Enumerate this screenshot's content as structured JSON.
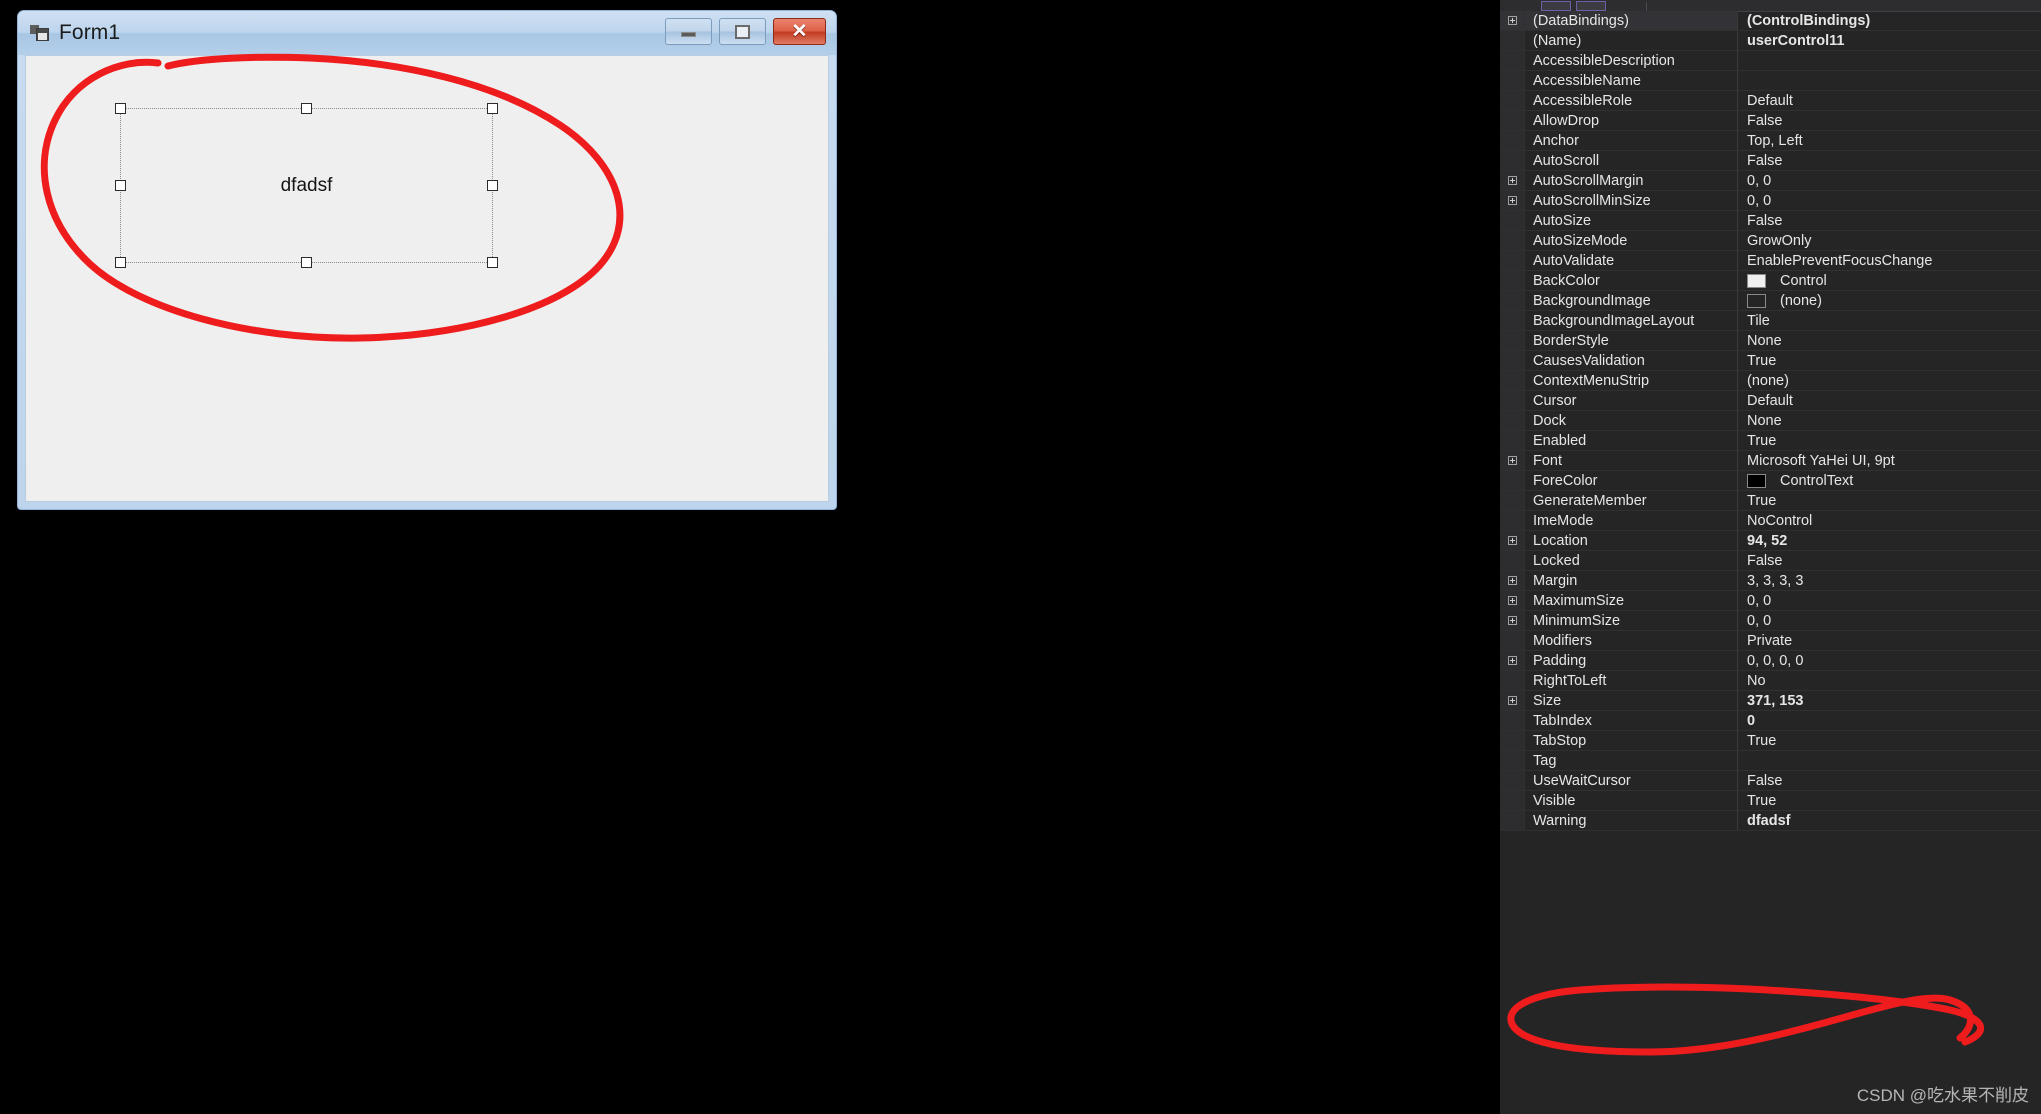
{
  "designer": {
    "window_title": "Form1",
    "icon": "form-icon",
    "controls": {
      "minimize_label": "—",
      "maximize_label": "□",
      "close_label": "✕"
    },
    "selected_control": {
      "label": "dfadsf",
      "name": "userControl11",
      "location": "94, 52",
      "size": "371, 153"
    }
  },
  "toolbar": {
    "items": [
      "categorized-icon",
      "alphabetical-icon",
      "properties-icon",
      "events-icon",
      "property-pages-icon"
    ]
  },
  "property_grid": {
    "rows": [
      {
        "name": "(DataBindings)",
        "value": "(ControlBindings)",
        "expandable": true,
        "bold": true,
        "selected": true
      },
      {
        "name": "(Name)",
        "value": "userControl11",
        "expandable": false,
        "bold": true,
        "selected": false
      },
      {
        "name": "AccessibleDescription",
        "value": "",
        "expandable": false,
        "bold": false,
        "selected": false
      },
      {
        "name": "AccessibleName",
        "value": "",
        "expandable": false,
        "bold": false,
        "selected": false
      },
      {
        "name": "AccessibleRole",
        "value": "Default",
        "expandable": false,
        "bold": false,
        "selected": false
      },
      {
        "name": "AllowDrop",
        "value": "False",
        "expandable": false,
        "bold": false,
        "selected": false
      },
      {
        "name": "Anchor",
        "value": "Top, Left",
        "expandable": false,
        "bold": false,
        "selected": false
      },
      {
        "name": "AutoScroll",
        "value": "False",
        "expandable": false,
        "bold": false,
        "selected": false
      },
      {
        "name": "AutoScrollMargin",
        "value": "0, 0",
        "expandable": true,
        "bold": false,
        "selected": false
      },
      {
        "name": "AutoScrollMinSize",
        "value": "0, 0",
        "expandable": true,
        "bold": false,
        "selected": false
      },
      {
        "name": "AutoSize",
        "value": "False",
        "expandable": false,
        "bold": false,
        "selected": false
      },
      {
        "name": "AutoSizeMode",
        "value": "GrowOnly",
        "expandable": false,
        "bold": false,
        "selected": false
      },
      {
        "name": "AutoValidate",
        "value": "EnablePreventFocusChange",
        "expandable": false,
        "bold": false,
        "selected": false
      },
      {
        "name": "BackColor",
        "value": "Control",
        "expandable": false,
        "bold": false,
        "selected": false,
        "swatch": "#f0f0f0"
      },
      {
        "name": "BackgroundImage",
        "value": "(none)",
        "expandable": false,
        "bold": false,
        "selected": false,
        "swatch": "#252526"
      },
      {
        "name": "BackgroundImageLayout",
        "value": "Tile",
        "expandable": false,
        "bold": false,
        "selected": false
      },
      {
        "name": "BorderStyle",
        "value": "None",
        "expandable": false,
        "bold": false,
        "selected": false
      },
      {
        "name": "CausesValidation",
        "value": "True",
        "expandable": false,
        "bold": false,
        "selected": false
      },
      {
        "name": "ContextMenuStrip",
        "value": "(none)",
        "expandable": false,
        "bold": false,
        "selected": false
      },
      {
        "name": "Cursor",
        "value": "Default",
        "expandable": false,
        "bold": false,
        "selected": false
      },
      {
        "name": "Dock",
        "value": "None",
        "expandable": false,
        "bold": false,
        "selected": false
      },
      {
        "name": "Enabled",
        "value": "True",
        "expandable": false,
        "bold": false,
        "selected": false
      },
      {
        "name": "Font",
        "value": "Microsoft YaHei UI, 9pt",
        "expandable": true,
        "bold": false,
        "selected": false
      },
      {
        "name": "ForeColor",
        "value": "ControlText",
        "expandable": false,
        "bold": false,
        "selected": false,
        "swatch": "#000000"
      },
      {
        "name": "GenerateMember",
        "value": "True",
        "expandable": false,
        "bold": false,
        "selected": false
      },
      {
        "name": "ImeMode",
        "value": "NoControl",
        "expandable": false,
        "bold": false,
        "selected": false
      },
      {
        "name": "Location",
        "value": "94, 52",
        "expandable": true,
        "bold": true,
        "selected": false
      },
      {
        "name": "Locked",
        "value": "False",
        "expandable": false,
        "bold": false,
        "selected": false
      },
      {
        "name": "Margin",
        "value": "3, 3, 3, 3",
        "expandable": true,
        "bold": false,
        "selected": false
      },
      {
        "name": "MaximumSize",
        "value": "0, 0",
        "expandable": true,
        "bold": false,
        "selected": false
      },
      {
        "name": "MinimumSize",
        "value": "0, 0",
        "expandable": true,
        "bold": false,
        "selected": false
      },
      {
        "name": "Modifiers",
        "value": "Private",
        "expandable": false,
        "bold": false,
        "selected": false
      },
      {
        "name": "Padding",
        "value": "0, 0, 0, 0",
        "expandable": true,
        "bold": false,
        "selected": false
      },
      {
        "name": "RightToLeft",
        "value": "No",
        "expandable": false,
        "bold": false,
        "selected": false
      },
      {
        "name": "Size",
        "value": "371, 153",
        "expandable": true,
        "bold": true,
        "selected": false
      },
      {
        "name": "TabIndex",
        "value": "0",
        "expandable": false,
        "bold": true,
        "selected": false
      },
      {
        "name": "TabStop",
        "value": "True",
        "expandable": false,
        "bold": false,
        "selected": false
      },
      {
        "name": "Tag",
        "value": "",
        "expandable": false,
        "bold": false,
        "selected": false
      },
      {
        "name": "UseWaitCursor",
        "value": "False",
        "expandable": false,
        "bold": false,
        "selected": false
      },
      {
        "name": "Visible",
        "value": "True",
        "expandable": false,
        "bold": false,
        "selected": false
      },
      {
        "name": "Warning",
        "value": "dfadsf",
        "expandable": false,
        "bold": true,
        "selected": false
      }
    ]
  },
  "annotations": {
    "color": "#ee1c1c",
    "shapes": [
      "ellipse-around-usercontrol",
      "ellipse-around-warning-row"
    ]
  },
  "watermark": {
    "text": "CSDN @吃水果不削皮"
  }
}
